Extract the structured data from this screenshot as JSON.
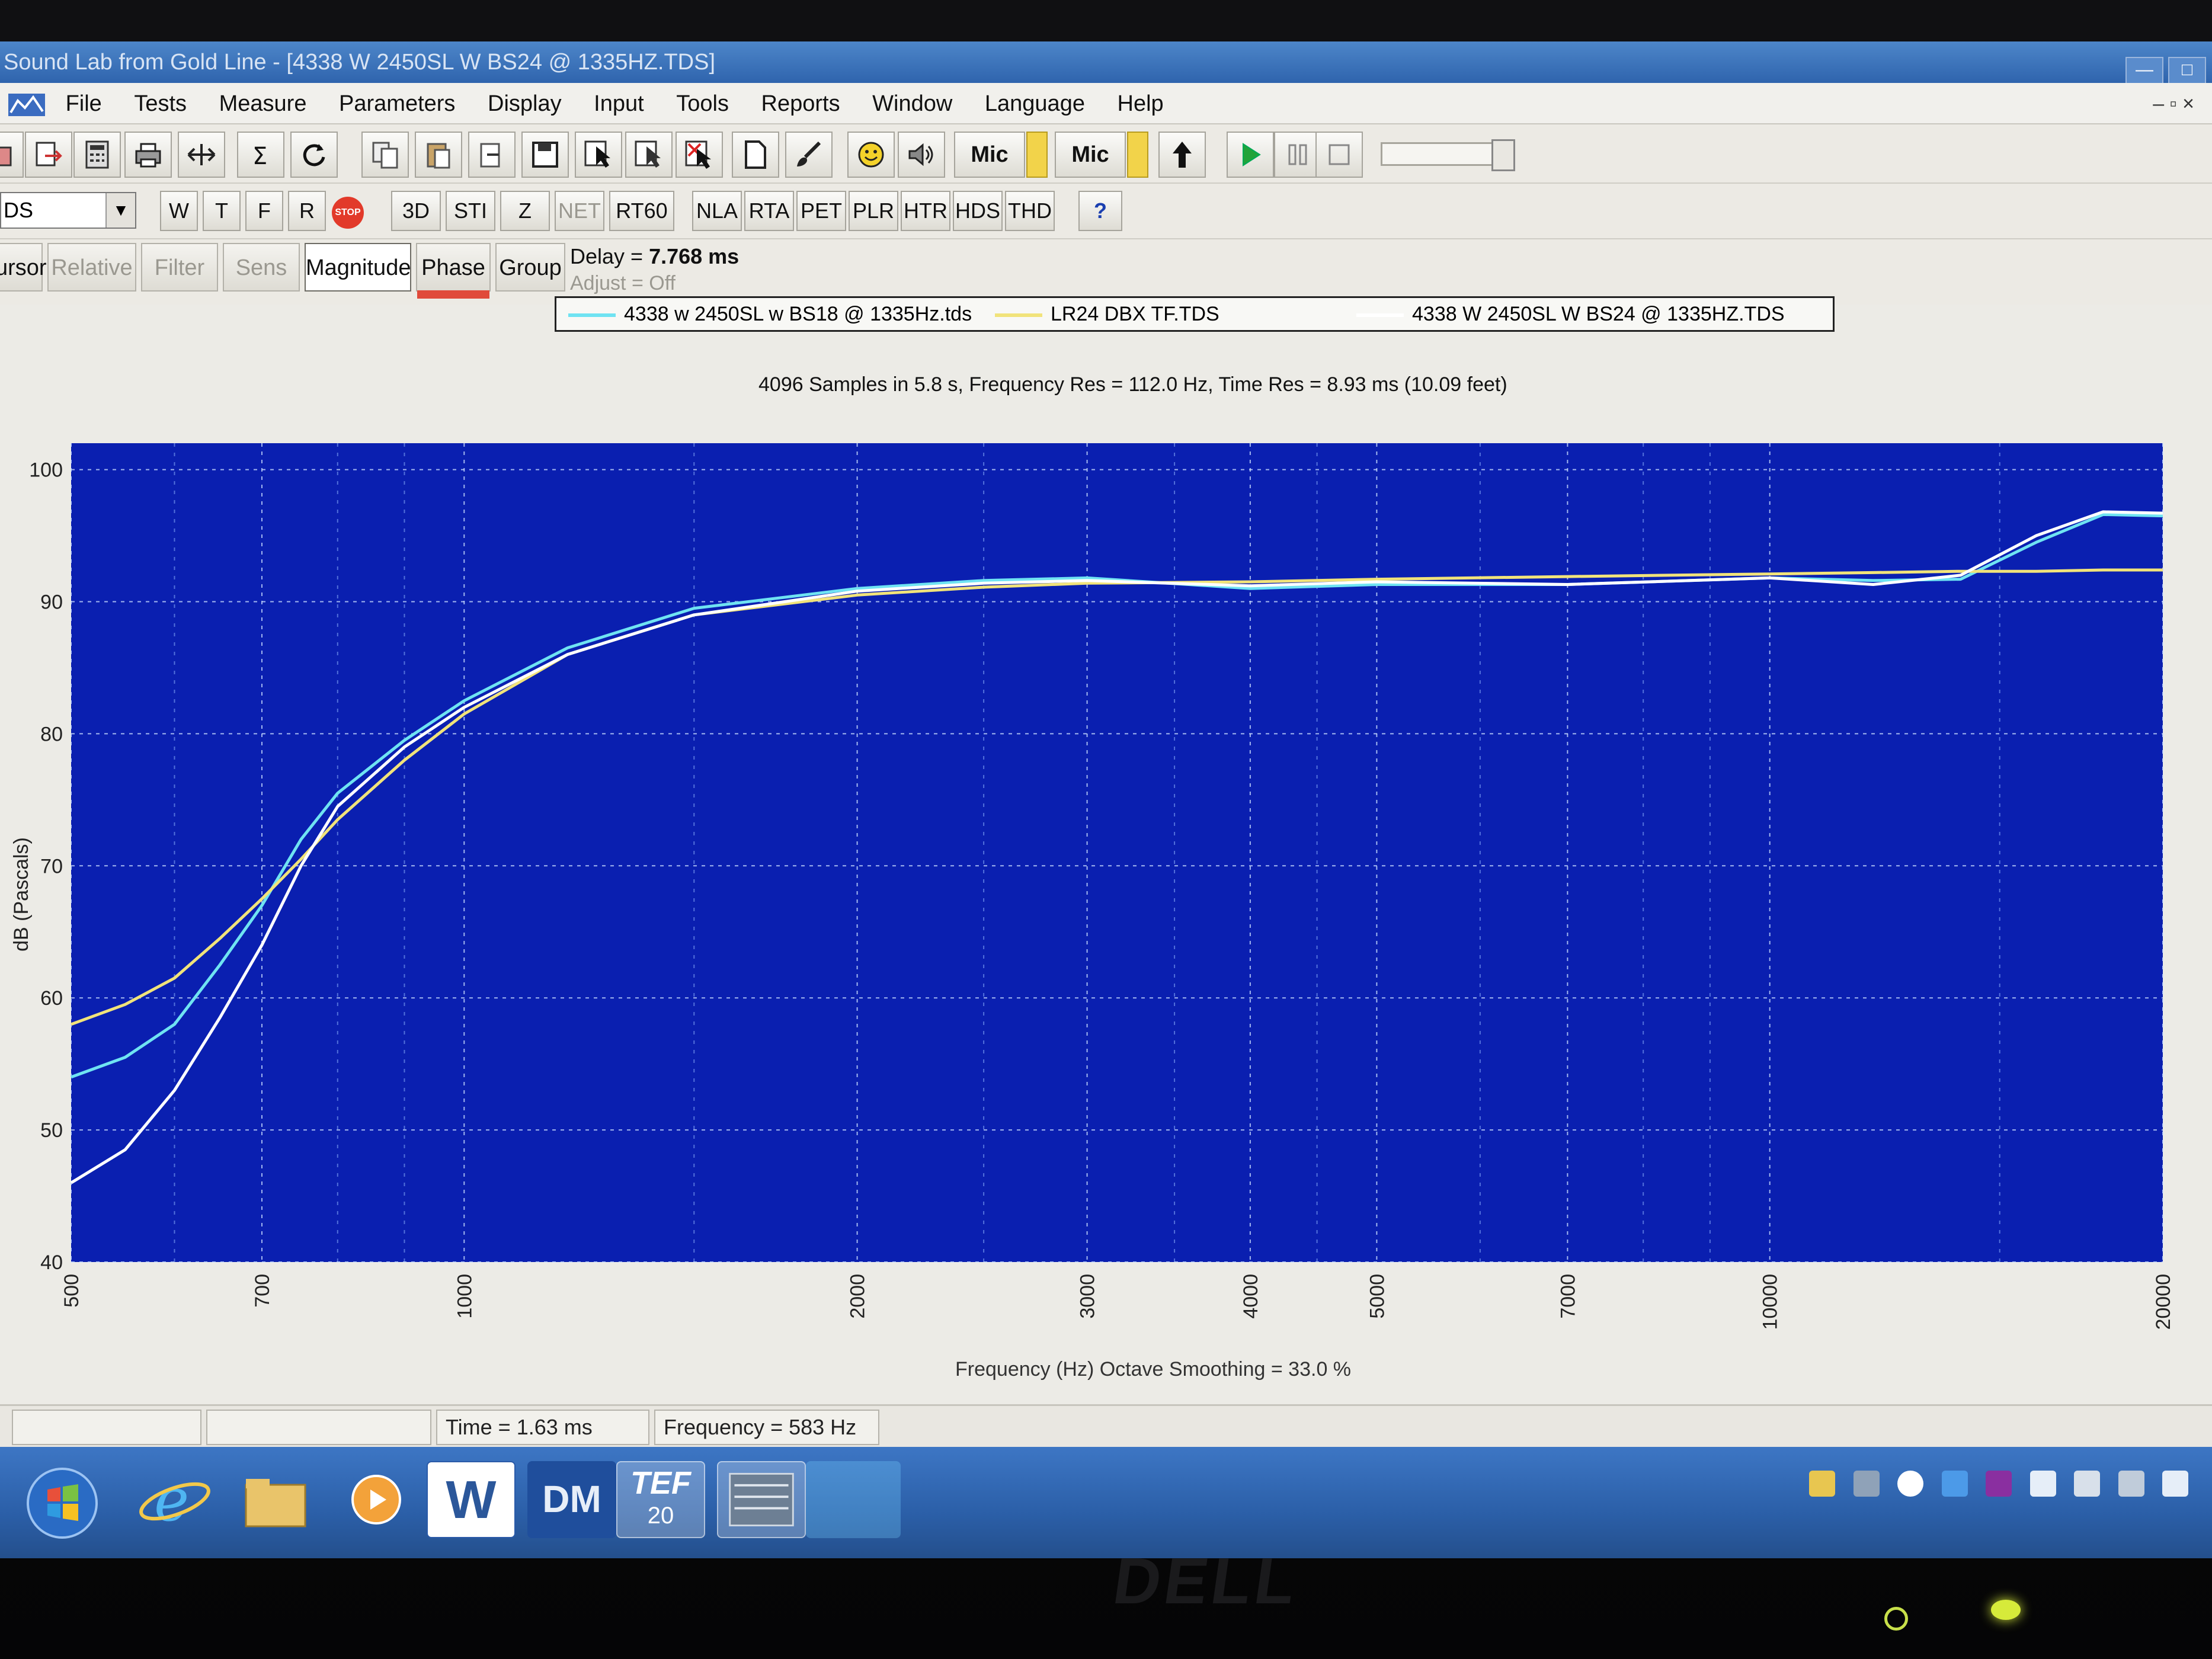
{
  "window": {
    "title": "Sound Lab from Gold Line - [4338 W 2450SL W BS24 @ 1335HZ.TDS]",
    "controls": [
      "—",
      "□"
    ]
  },
  "menu": {
    "items": [
      "File",
      "Tests",
      "Measure",
      "Parameters",
      "Display",
      "Input",
      "Tools",
      "Reports",
      "Window",
      "Language",
      "Help"
    ],
    "mdi_controls": "– ▫ ×"
  },
  "toolbar1": {
    "mic1": "Mic",
    "mic2": "Mic"
  },
  "toolbar2": {
    "combo_value": "DS",
    "buttons": [
      "W",
      "T",
      "F",
      "R"
    ],
    "stop_label": "STOP",
    "buttons2": [
      "3D",
      "STI",
      "Z",
      "NET",
      "RT60"
    ],
    "buttons3": [
      "NLA",
      "RTA",
      "PET",
      "PLR",
      "HTR",
      "HDS",
      "THD"
    ],
    "help": "?"
  },
  "tabs": {
    "items": [
      "ursor",
      "Relative",
      "Filter",
      "Sens",
      "Magnitude",
      "Phase",
      "Group"
    ],
    "delay_label": "Delay = ",
    "delay_value": "7.768 ms",
    "adjust": "Adjust = Off"
  },
  "legend": {
    "entries": [
      {
        "label": "4338 w 2450SL w BS18 @ 1335Hz.tds",
        "color": "#6fe3f2"
      },
      {
        "label": "LR24 DBX TF.TDS",
        "color": "#f1e37a"
      },
      {
        "label": "4338 W 2450SL W BS24 @ 1335HZ.TDS",
        "color": "#ffffff"
      }
    ]
  },
  "chart_data": {
    "type": "line",
    "title": "4096 Samples in 5.8 s, Frequency Res = 112.0 Hz, Time Res = 8.93 ms (10.09 feet)",
    "xlabel": "Frequency (Hz) Octave Smoothing = 33.0 %",
    "ylabel": "dB (Pascals)",
    "x_scale": "log",
    "xlim": [
      500,
      20000
    ],
    "ylim": [
      40,
      102
    ],
    "x_ticks": [
      500,
      700,
      1000,
      2000,
      3000,
      4000,
      5000,
      7000,
      10000,
      20000
    ],
    "y_ticks": [
      40,
      50,
      60,
      70,
      80,
      90,
      100
    ],
    "grid": true,
    "background": "#0a1fb0",
    "series": [
      {
        "name": "4338 w 2450SL w BS18 @ 1335Hz.tds",
        "color": "#6fe3f2",
        "x": [
          500,
          550,
          600,
          650,
          700,
          750,
          800,
          900,
          1000,
          1200,
          1500,
          2000,
          2500,
          3000,
          4000,
          5000,
          7000,
          10000,
          12000,
          14000,
          16000,
          18000,
          20000
        ],
        "y": [
          54,
          55.5,
          58,
          62.5,
          67,
          72,
          75.5,
          79.5,
          82.5,
          86.5,
          89.5,
          91,
          91.6,
          91.8,
          91,
          91.3,
          91.3,
          91.8,
          91.6,
          91.7,
          94.5,
          96.6,
          96.5
        ]
      },
      {
        "name": "LR24 DBX TF.TDS",
        "color": "#f1e37a",
        "x": [
          500,
          550,
          600,
          650,
          700,
          750,
          800,
          900,
          1000,
          1200,
          1500,
          2000,
          2500,
          3000,
          4000,
          5000,
          7000,
          10000,
          12000,
          14000,
          16000,
          18000,
          20000
        ],
        "y": [
          58,
          59.5,
          61.5,
          64.5,
          67.5,
          70.5,
          73.5,
          78,
          81.5,
          86,
          89,
          90.5,
          91.1,
          91.4,
          91.5,
          91.7,
          91.9,
          92.1,
          92.2,
          92.3,
          92.3,
          92.4,
          92.4
        ]
      },
      {
        "name": "4338 W 2450SL W BS24 @ 1335HZ.TDS",
        "color": "#ffffff",
        "x": [
          500,
          550,
          600,
          650,
          700,
          750,
          800,
          900,
          1000,
          1200,
          1500,
          2000,
          2500,
          3000,
          4000,
          5000,
          7000,
          10000,
          12000,
          14000,
          16000,
          18000,
          20000
        ],
        "y": [
          46,
          48.5,
          53,
          58.5,
          64,
          70,
          74.5,
          79,
          82,
          86,
          89,
          90.8,
          91.4,
          91.6,
          91.2,
          91.5,
          91.3,
          91.8,
          91.3,
          92,
          95,
          96.8,
          96.7
        ]
      }
    ]
  },
  "status": {
    "time": "Time = 1.63 ms",
    "frequency": "Frequency = 583 Hz"
  },
  "taskbar": {
    "apps": [
      "start",
      "internet-explorer",
      "file-explorer",
      "media-player",
      "word",
      "dm",
      "tef-20",
      "sound-lab"
    ],
    "tef_label": "TEF",
    "tef_num": "20",
    "dm_label": "DM",
    "word_label": "W"
  },
  "bezel": {
    "brand": "DELL"
  }
}
